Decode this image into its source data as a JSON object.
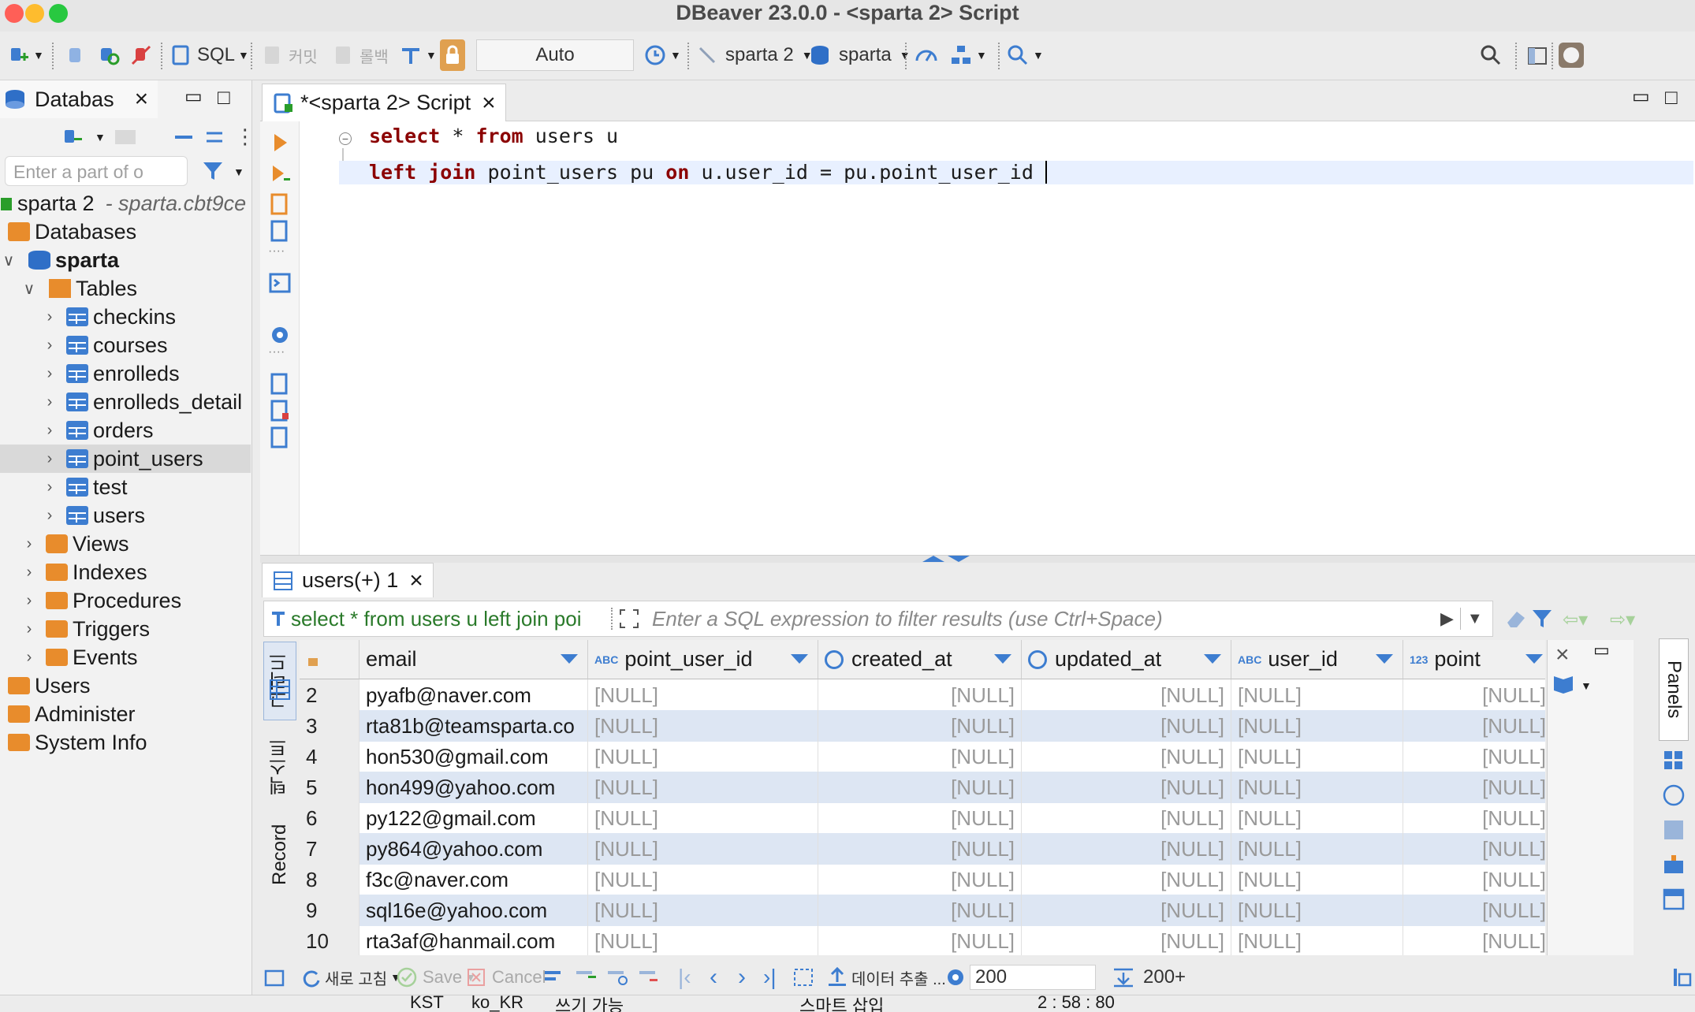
{
  "window": {
    "title": "DBeaver 23.0.0 - <sparta 2> Script",
    "traffic_colors": [
      "#ff5f57",
      "#febc2e",
      "#28c840"
    ]
  },
  "toolbar": {
    "sql_label": "SQL",
    "commit_label": "커밋",
    "rollback_label": "롤백",
    "transaction_mode": "Auto",
    "datasource": "sparta 2",
    "schema": "sparta"
  },
  "navigator": {
    "tab_label": "Databas",
    "filter_placeholder": "Enter a part of o",
    "connection": {
      "name": "sparta 2",
      "host": "- sparta.cbt9ce"
    },
    "databases_label": "Databases",
    "schema_label": "sparta",
    "tables_label": "Tables",
    "tables": [
      "checkins",
      "courses",
      "enrolleds",
      "enrolleds_detail",
      "orders",
      "point_users",
      "test",
      "users"
    ],
    "selected_table": "point_users",
    "folders": [
      "Views",
      "Indexes",
      "Procedures",
      "Triggers",
      "Events"
    ],
    "root_items": [
      "Users",
      "Administer",
      "System Info"
    ]
  },
  "editor": {
    "tab_label": "*<sparta 2> Script",
    "code": {
      "line1": {
        "kw1": "select",
        "t1": " * ",
        "kw2": "from",
        "t2": " users u"
      },
      "line2": {
        "kw1": "left join",
        "t1": " point_users pu ",
        "kw2": "on",
        "t2": " u.user_id = pu.point_user_id "
      }
    }
  },
  "results": {
    "tab_label": "users(+) 1",
    "query_preview": "select * from users u left join poi",
    "filter_placeholder": "Enter a SQL expression to filter results (use Ctrl+Space)",
    "side_tabs": [
      "그리드",
      "텍스트",
      "Record"
    ],
    "columns": [
      {
        "name": "email",
        "type": ""
      },
      {
        "name": "point_user_id",
        "type": "ABC"
      },
      {
        "name": "created_at",
        "type": "clock"
      },
      {
        "name": "updated_at",
        "type": "clock"
      },
      {
        "name": "user_id",
        "type": "ABC"
      },
      {
        "name": "point",
        "type": "123"
      }
    ],
    "rows": [
      {
        "n": "2",
        "email": "pyafb@naver.com",
        "vals": [
          "[NULL]",
          "[NULL]",
          "[NULL]",
          "[NULL]",
          "[NULL]"
        ]
      },
      {
        "n": "3",
        "email": "rta81b@teamsparta.co",
        "vals": [
          "[NULL]",
          "[NULL]",
          "[NULL]",
          "[NULL]",
          "[NULL]"
        ]
      },
      {
        "n": "4",
        "email": "hon530@gmail.com",
        "vals": [
          "[NULL]",
          "[NULL]",
          "[NULL]",
          "[NULL]",
          "[NULL]"
        ]
      },
      {
        "n": "5",
        "email": "hon499@yahoo.com",
        "vals": [
          "[NULL]",
          "[NULL]",
          "[NULL]",
          "[NULL]",
          "[NULL]"
        ]
      },
      {
        "n": "6",
        "email": "py122@gmail.com",
        "vals": [
          "[NULL]",
          "[NULL]",
          "[NULL]",
          "[NULL]",
          "[NULL]"
        ]
      },
      {
        "n": "7",
        "email": "py864@yahoo.com",
        "vals": [
          "[NULL]",
          "[NULL]",
          "[NULL]",
          "[NULL]",
          "[NULL]"
        ]
      },
      {
        "n": "8",
        "email": "f3c@naver.com",
        "vals": [
          "[NULL]",
          "[NULL]",
          "[NULL]",
          "[NULL]",
          "[NULL]"
        ]
      },
      {
        "n": "9",
        "email": "sql16e@yahoo.com",
        "vals": [
          "[NULL]",
          "[NULL]",
          "[NULL]",
          "[NULL]",
          "[NULL]"
        ]
      },
      {
        "n": "10",
        "email": "rta3af@hanmail.com",
        "vals": [
          "[NULL]",
          "[NULL]",
          "[NULL]",
          "[NULL]",
          "[NULL]"
        ]
      }
    ],
    "panels_label": "Panels",
    "bottom": {
      "refresh": "새로 고침",
      "save": "Save",
      "cancel": "Cancel",
      "export": "데이터 추출 ...",
      "fetch_size": "200",
      "row_count": "200+"
    }
  },
  "statusbar": {
    "timezone": "KST",
    "locale": "ko_KR",
    "mode": "쓰기 가능",
    "insert_mode": "스마트 삽입",
    "position": "2 : 58 : 80"
  }
}
